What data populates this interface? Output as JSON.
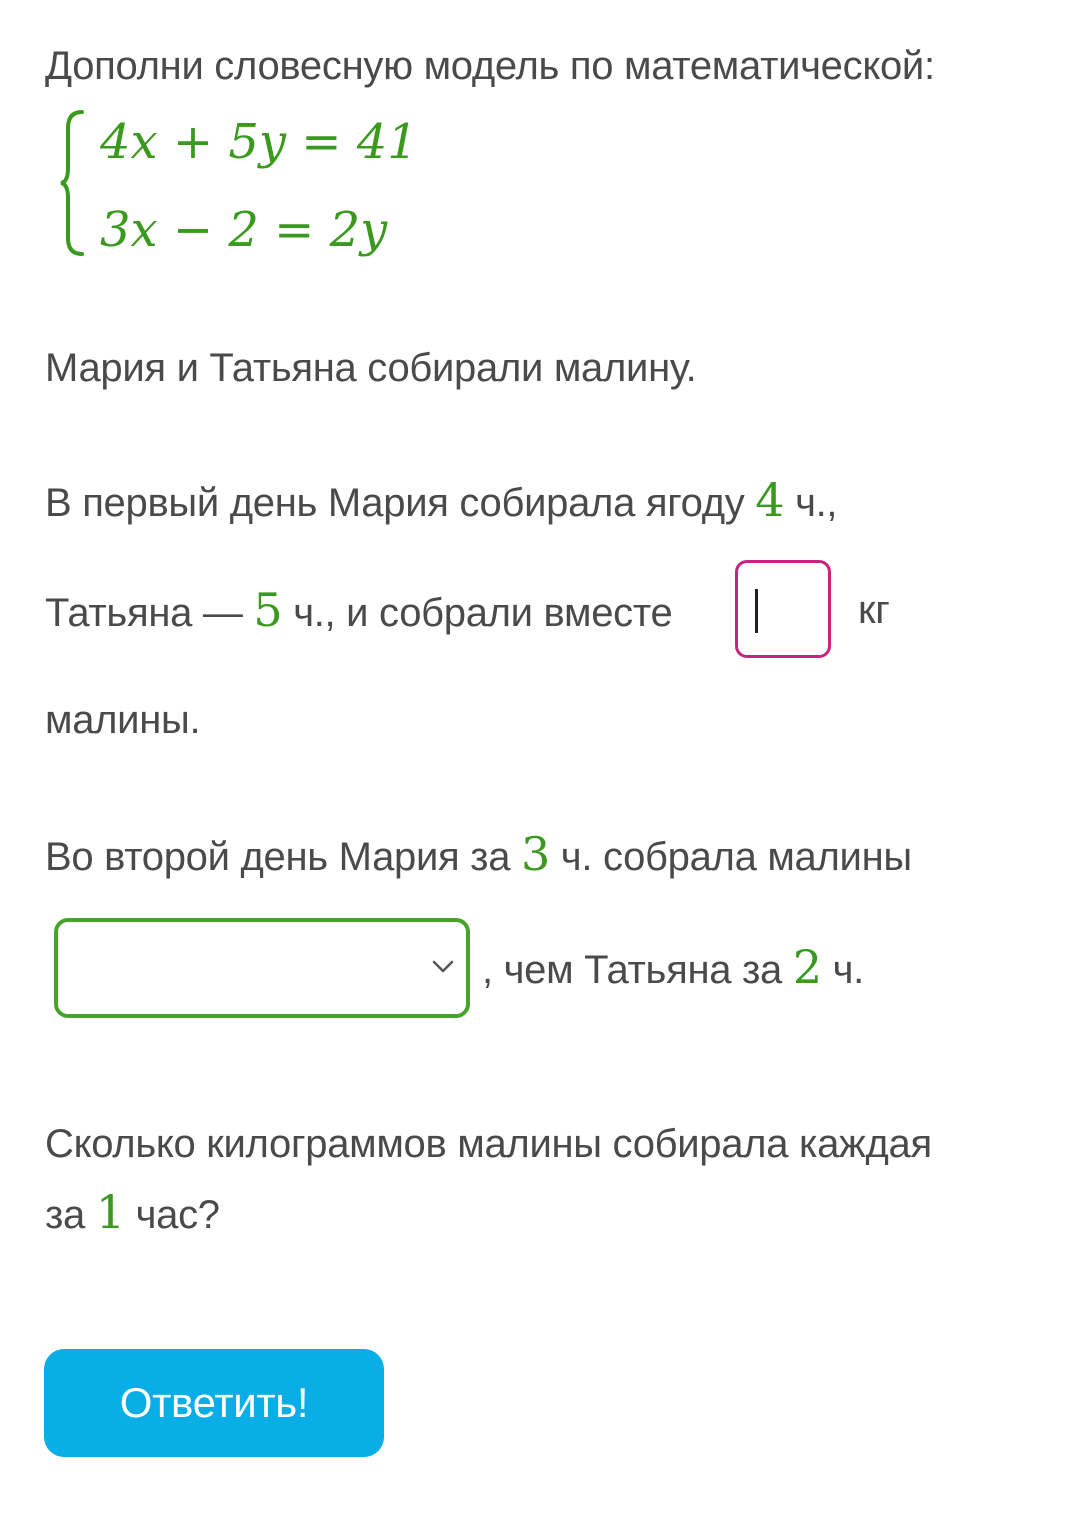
{
  "prompt": "Дополни словесную модель по математической:",
  "system": {
    "equation_1": "4x + 5y = 41",
    "equation_2": "3x − 2 = 2y"
  },
  "intro": "Мария и Татьяна собирали малину.",
  "day1": {
    "part1": "В первый день Мария собирала ягоду",
    "maria_hours": "4",
    "part2": "ч.,",
    "part3": "Татьяна —",
    "tatiana_hours": "5",
    "part4": "ч., и собрали вместе",
    "input_value": "",
    "unit": "кг",
    "part5": "малины."
  },
  "day2": {
    "part1": "Во второй день Мария за",
    "maria_hours": "3",
    "part2": "ч. собрала малины",
    "select_value": "",
    "part3": ", чем Татьяна за",
    "tatiana_hours": "2",
    "part4": "ч."
  },
  "question": {
    "line1": "Сколько килограммов малины собирала каждая",
    "part1": "за",
    "hours": "1",
    "part2": "час?"
  },
  "submit_label": "Ответить!",
  "colors": {
    "math_green": "#3a9a1e",
    "input_border": "#c8247f",
    "select_border": "#47a42a",
    "button_bg": "#0aaee6"
  },
  "icons": {
    "select_arrow": "chevron-down-icon"
  }
}
